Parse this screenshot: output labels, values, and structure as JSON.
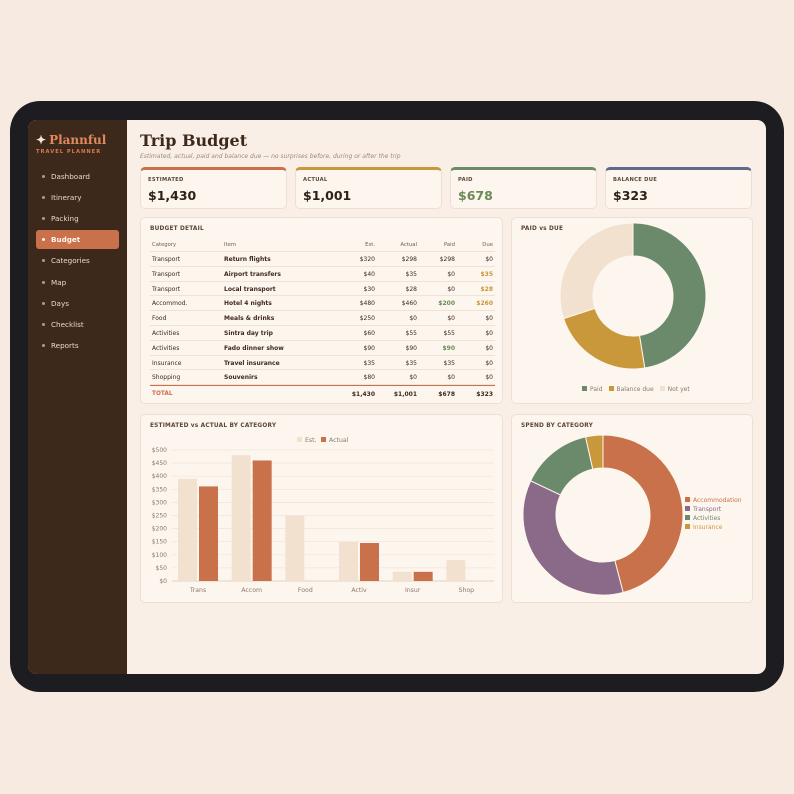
{
  "app": {
    "name": "Plannful",
    "tagline": "TRAVEL PLANNER"
  },
  "nav": [
    {
      "label": "Dashboard",
      "active": false
    },
    {
      "label": "Itinerary",
      "active": false
    },
    {
      "label": "Packing",
      "active": false
    },
    {
      "label": "Budget",
      "active": true
    },
    {
      "label": "Categories",
      "active": false
    },
    {
      "label": "Map",
      "active": false
    },
    {
      "label": "Days",
      "active": false
    },
    {
      "label": "Checklist",
      "active": false
    },
    {
      "label": "Reports",
      "active": false
    }
  ],
  "page": {
    "title": "Trip Budget",
    "subtitle": "Estimated, actual, paid and balance due — no surprises before, during or after the trip"
  },
  "kpis": [
    {
      "label": "ESTIMATED",
      "value": "$1,430",
      "accent": "#c9714a",
      "value_color": "#2f2118"
    },
    {
      "label": "ACTUAL",
      "value": "$1,001",
      "accent": "#c9983b",
      "value_color": "#2f2118"
    },
    {
      "label": "PAID",
      "value": "$678",
      "accent": "#6b8a6b",
      "value_color": "#6b8a56"
    },
    {
      "label": "BALANCE DUE",
      "value": "$323",
      "accent": "#5d6a8a",
      "value_color": "#2f2118"
    }
  ],
  "budget_detail": {
    "title": "BUDGET DETAIL",
    "columns": {
      "category": "Category",
      "item": "Item",
      "est": "Est.",
      "actual": "Actual",
      "paid": "Paid",
      "due": "Due"
    },
    "rows": [
      {
        "category": "Transport",
        "item": "Return flights",
        "est": "$320",
        "actual": "$298",
        "paid": "$298",
        "due": "$0",
        "paid_hl": "",
        "due_hl": ""
      },
      {
        "category": "Transport",
        "item": "Airport transfers",
        "est": "$40",
        "actual": "$35",
        "paid": "$0",
        "due": "$35",
        "paid_hl": "",
        "due_hl": "amber"
      },
      {
        "category": "Transport",
        "item": "Local transport",
        "est": "$30",
        "actual": "$28",
        "paid": "$0",
        "due": "$28",
        "paid_hl": "",
        "due_hl": "amber"
      },
      {
        "category": "Accommod.",
        "item": "Hotel 4 nights",
        "est": "$480",
        "actual": "$460",
        "paid": "$200",
        "due": "$260",
        "paid_hl": "green",
        "due_hl": "amber"
      },
      {
        "category": "Food",
        "item": "Meals & drinks",
        "est": "$250",
        "actual": "$0",
        "paid": "$0",
        "due": "$0",
        "paid_hl": "",
        "due_hl": ""
      },
      {
        "category": "Activities",
        "item": "Sintra day trip",
        "est": "$60",
        "actual": "$55",
        "paid": "$55",
        "due": "$0",
        "paid_hl": "",
        "due_hl": ""
      },
      {
        "category": "Activities",
        "item": "Fado dinner show",
        "est": "$90",
        "actual": "$90",
        "paid": "$90",
        "due": "$0",
        "paid_hl": "green",
        "due_hl": ""
      },
      {
        "category": "Insurance",
        "item": "Travel insurance",
        "est": "$35",
        "actual": "$35",
        "paid": "$35",
        "due": "$0",
        "paid_hl": "",
        "due_hl": ""
      },
      {
        "category": "Shopping",
        "item": "Souvenirs",
        "est": "$80",
        "actual": "$0",
        "paid": "$0",
        "due": "$0",
        "paid_hl": "",
        "due_hl": ""
      }
    ],
    "total": {
      "label": "TOTAL",
      "est": "$1,430",
      "actual": "$1,001",
      "paid": "$678",
      "due": "$323"
    }
  },
  "chart_data": [
    {
      "type": "pie",
      "title": "PAID vs DUE",
      "categories": [
        "Paid",
        "Balance due",
        "Not yet"
      ],
      "values": [
        678,
        323,
        429
      ],
      "colors": [
        "#6b8a6b",
        "#c9983b",
        "#f2e1cf"
      ],
      "legend": "bottom"
    },
    {
      "type": "bar",
      "title": "ESTIMATED vs ACTUAL BY CATEGORY",
      "categories": [
        "Trans",
        "Accom",
        "Food",
        "Activ",
        "Insur",
        "Shop"
      ],
      "series": [
        {
          "name": "Est.",
          "values": [
            390,
            480,
            250,
            150,
            35,
            80
          ],
          "color": "#f2e1cf"
        },
        {
          "name": "Actual",
          "values": [
            361,
            460,
            0,
            145,
            35,
            0
          ],
          "color": "#c9714a"
        }
      ],
      "ylim": [
        0,
        500
      ],
      "yticks": [
        "$0",
        "$50",
        "$100",
        "$150",
        "$200",
        "$250",
        "$300",
        "$350",
        "$400",
        "$450",
        "$500"
      ],
      "grid": true,
      "legend": "top-center"
    },
    {
      "type": "pie",
      "title": "SPEND BY CATEGORY",
      "categories": [
        "Accommodation",
        "Transport",
        "Activities",
        "Insurance"
      ],
      "values": [
        460,
        361,
        145,
        35
      ],
      "colors": [
        "#c9714a",
        "#8a6a88",
        "#6b8a6b",
        "#c9983b"
      ],
      "legend": "right"
    }
  ]
}
